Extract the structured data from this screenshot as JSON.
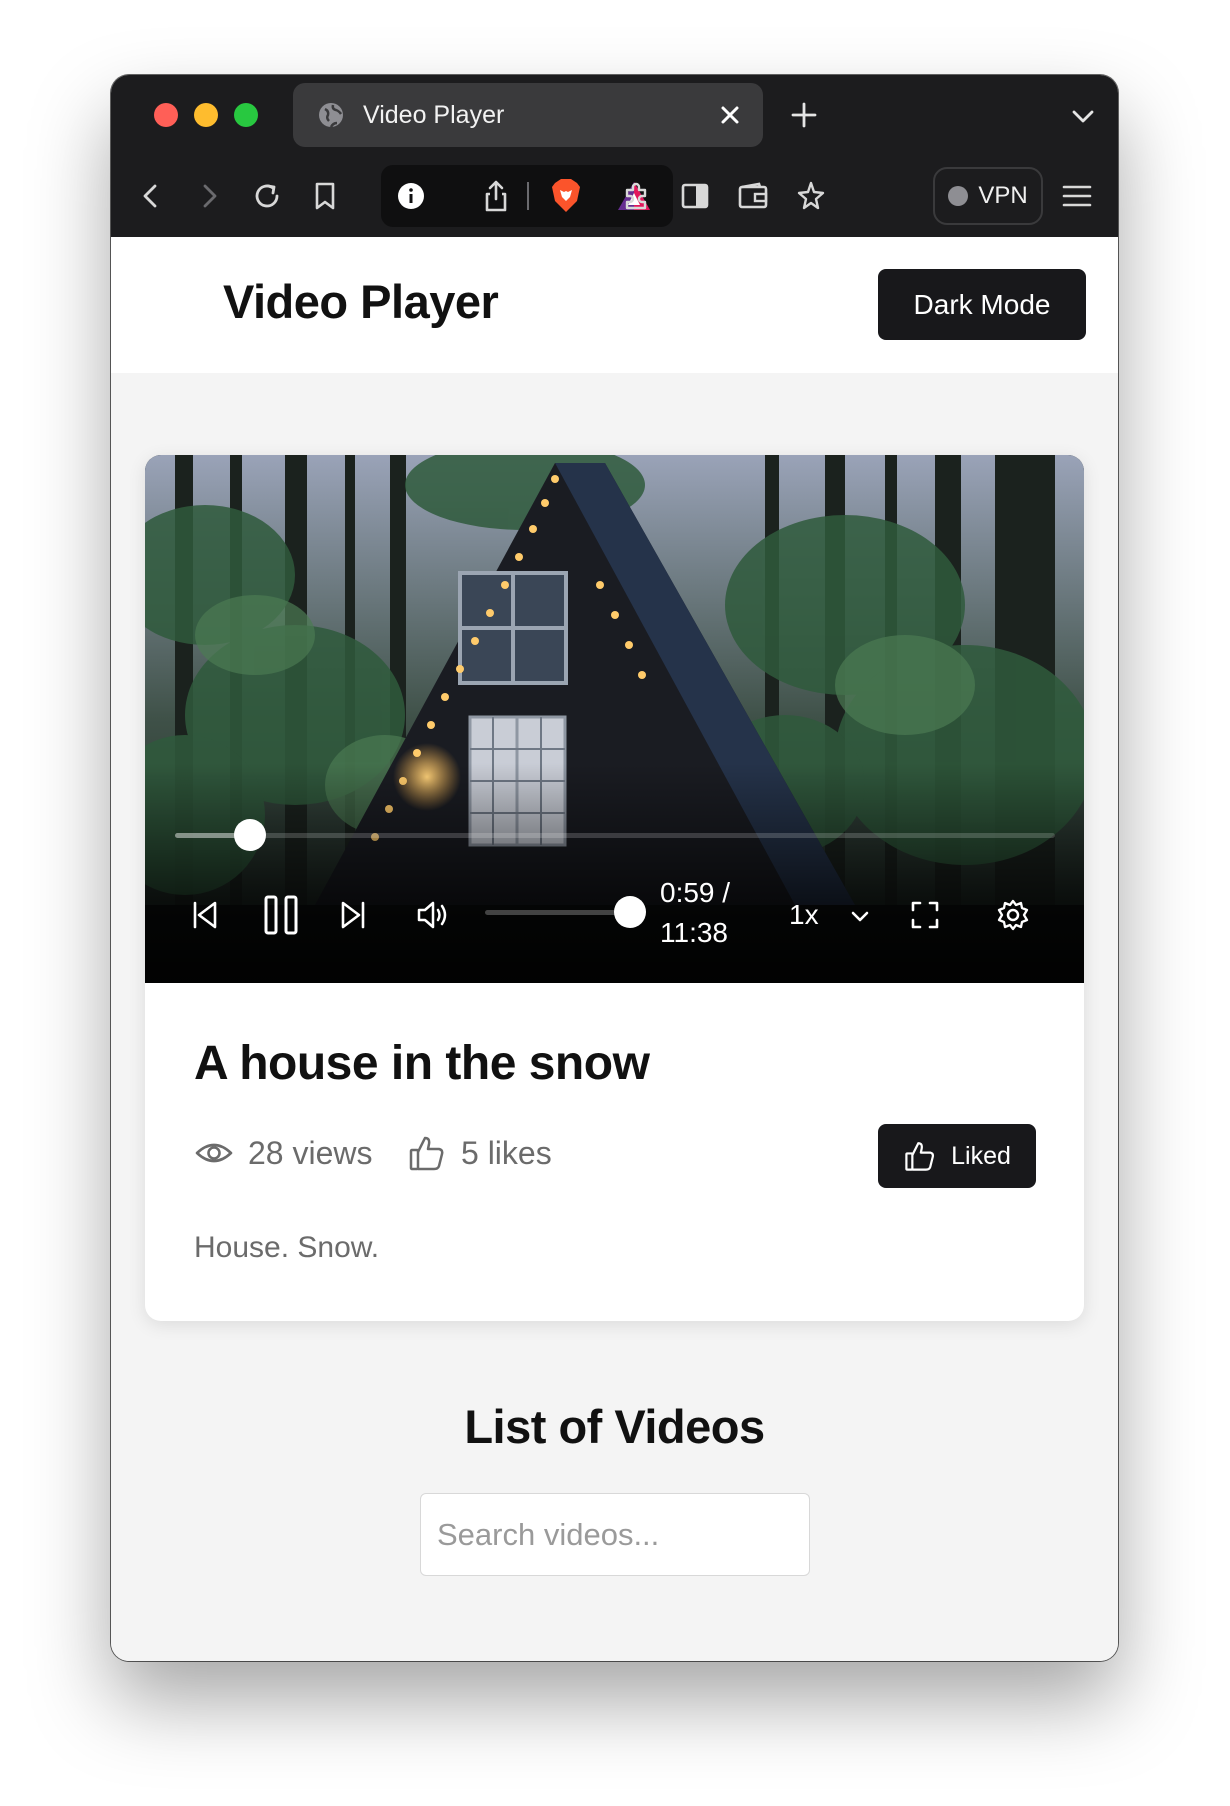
{
  "browser": {
    "tab_title": "Video Player",
    "vpn_label": "VPN",
    "icons": [
      "globe-icon",
      "close-icon",
      "plus-icon",
      "chevron-down-icon",
      "back-icon",
      "forward-icon",
      "reload-icon",
      "bookmark-icon",
      "info-icon",
      "share-icon",
      "brave-shield-icon",
      "brave-rewards-icon",
      "extensions-icon",
      "sidebar-icon",
      "wallet-icon",
      "leo-icon",
      "menu-icon"
    ]
  },
  "header": {
    "title": "Video Player",
    "dark_mode_label": "Dark Mode"
  },
  "player": {
    "current_time": "0:59 /",
    "duration": "11:38",
    "speed": "1x",
    "progress_fraction": 0.085,
    "volume_fraction": 1.0
  },
  "video": {
    "title": "A house in the snow",
    "views": "28 views",
    "likes": "5 likes",
    "liked_label": "Liked",
    "description": "House. Snow."
  },
  "list": {
    "title": "List of Videos",
    "search_placeholder": "Search videos..."
  },
  "colors": {
    "accent_dark": "#18181b",
    "muted_text": "#6b6b6b",
    "page_bg": "#f4f4f4"
  }
}
